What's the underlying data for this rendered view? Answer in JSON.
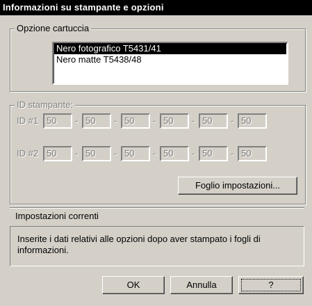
{
  "window": {
    "title": "Informazioni su stampante e opzioni"
  },
  "cartridge_group": {
    "title": "Opzione cartuccia",
    "items": [
      {
        "label": "Nero fotografico T5431/41",
        "selected": true
      },
      {
        "label": "Nero matte T5438/48",
        "selected": false
      }
    ]
  },
  "printer_id_group": {
    "title": "ID stampante:",
    "row1_label": "ID #1",
    "row2_label": "ID #2",
    "row1_values": [
      "50",
      "50",
      "50",
      "50",
      "50",
      "50"
    ],
    "row2_values": [
      "50",
      "50",
      "50",
      "50",
      "50",
      "50"
    ],
    "separator": "-",
    "settings_sheet_button": "Foglio impostazioni..."
  },
  "current_settings": {
    "label": "Impostazioni correnti",
    "info_text": "Inserite i dati relativi alle opzioni dopo aver stampato i fogli di informazioni."
  },
  "buttons": {
    "ok": "OK",
    "cancel": "Annulla",
    "help": "?"
  },
  "colors": {
    "face": "#d4d0c8",
    "selection": "#000000",
    "disabled_text": "#808080"
  }
}
